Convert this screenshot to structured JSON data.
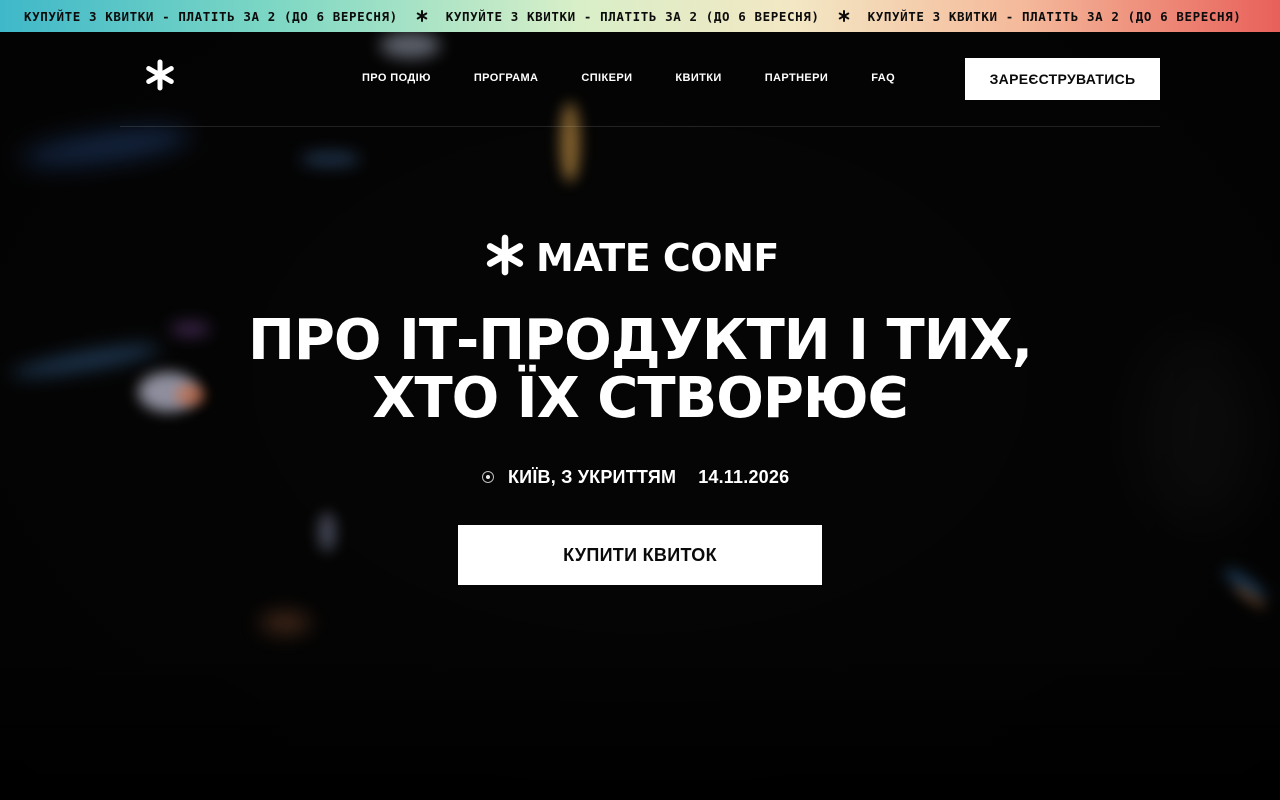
{
  "promo": {
    "text": "КУПУЙТЕ 3 КВИТКИ - ПЛАТІТЬ ЗА 2 (ДО 6 ВЕРЕСНЯ)",
    "separator_icon": "asterisk-icon"
  },
  "header": {
    "logo_icon": "asterisk-logo-icon",
    "nav": [
      {
        "label": "ПРО ПОДІЮ"
      },
      {
        "label": "ПРОГРАМА"
      },
      {
        "label": "СПІКЕРИ"
      },
      {
        "label": "КВИТКИ"
      },
      {
        "label": "ПАРТНЕРИ"
      },
      {
        "label": "FAQ"
      }
    ],
    "register_label": "ЗАРЕЄСТРУВАТИСЬ"
  },
  "hero": {
    "brand_name": "MATE CONF",
    "headline_line1": "ПРО ІТ-ПРОДУКТИ І ТИХ,",
    "headline_line2": "ХТО ЇХ СТВОРЮЄ",
    "location": "КИЇВ, З УКРИТТЯМ",
    "date": "14.11.2026",
    "buy_label": "КУПИТИ КВИТОК"
  },
  "colors": {
    "background": "#050505",
    "button_bg": "#ffffff",
    "button_text": "#0a0a0a",
    "promo_gradient_start": "#3fb8c9",
    "promo_gradient_end": "#e8605a"
  }
}
